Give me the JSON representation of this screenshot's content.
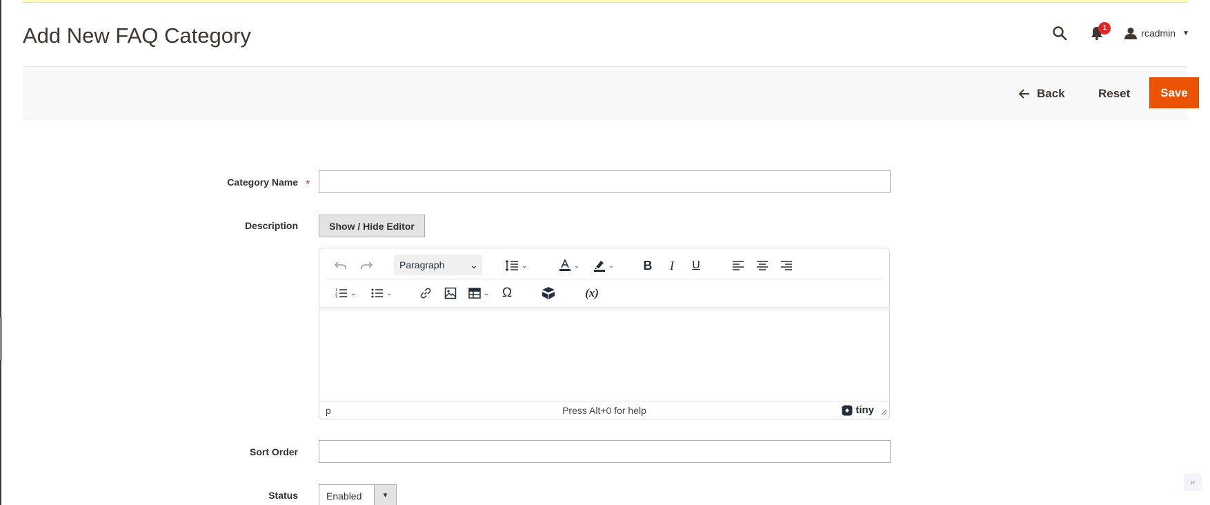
{
  "page": {
    "title": "Add New FAQ Category"
  },
  "header": {
    "search_icon": "search-icon",
    "notifications_count": "1",
    "user_name": "rcadmin"
  },
  "actions": {
    "back_label": "Back",
    "reset_label": "Reset",
    "save_label": "Save"
  },
  "form": {
    "category_name": {
      "label": "Category Name",
      "required_mark": "*",
      "value": ""
    },
    "description": {
      "label": "Description",
      "toggle_label": "Show / Hide Editor",
      "editor": {
        "block_format": "Paragraph",
        "path": "p",
        "help_text": "Press Alt+0 for help",
        "brand": "tiny"
      }
    },
    "sort_order": {
      "label": "Sort Order",
      "value": ""
    },
    "status": {
      "label": "Status",
      "selected": "Enabled"
    }
  },
  "colors": {
    "accent": "#eb5202",
    "badge": "#e22626",
    "title": "#41362f"
  }
}
